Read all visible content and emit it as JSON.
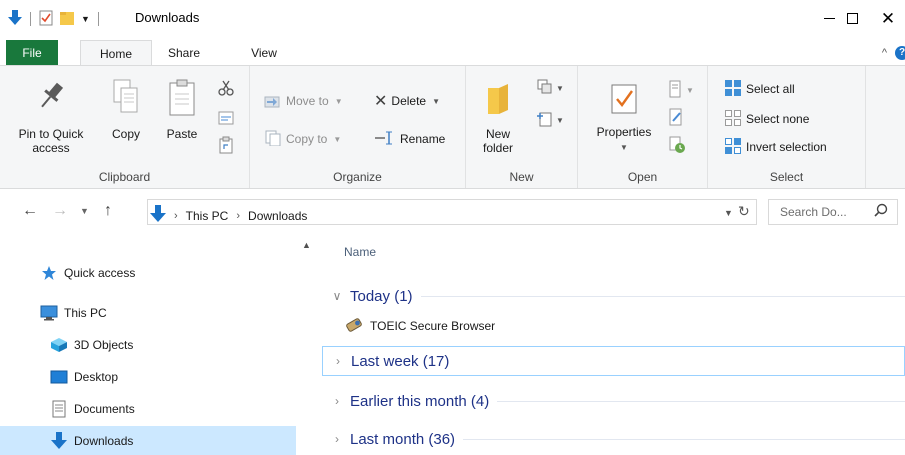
{
  "window": {
    "title": "Downloads",
    "qat": {
      "customize_glyph": "▼"
    },
    "controls": {
      "close_glyph": "✕"
    }
  },
  "tabs": {
    "file": "File",
    "home": "Home",
    "share": "Share",
    "view": "View",
    "collapse_glyph": "^",
    "help_glyph": "?"
  },
  "ribbon": {
    "clipboard": {
      "label": "Clipboard",
      "pin": "Pin to Quick\naccess",
      "copy": "Copy",
      "paste": "Paste"
    },
    "organize": {
      "label": "Organize",
      "move_to": "Move to",
      "copy_to": "Copy to",
      "delete": "Delete",
      "rename": "Rename"
    },
    "new": {
      "label": "New",
      "new_folder": "New\nfolder"
    },
    "open": {
      "label": "Open",
      "properties": "Properties"
    },
    "select": {
      "label": "Select",
      "select_all": "Select all",
      "select_none": "Select none",
      "invert_selection": "Invert selection"
    }
  },
  "address": {
    "crumbs": [
      "This PC",
      "Downloads"
    ],
    "search_placeholder": "Search Do..."
  },
  "nav_pane": {
    "items": [
      {
        "label": "Quick access",
        "icon": "star-icon"
      },
      {
        "label": "This PC",
        "icon": "computer-icon"
      },
      {
        "label": "3D Objects",
        "icon": "cube-icon"
      },
      {
        "label": "Desktop",
        "icon": "desktop-icon"
      },
      {
        "label": "Documents",
        "icon": "documents-icon"
      },
      {
        "label": "Downloads",
        "icon": "download-arrow-icon",
        "selected": true
      }
    ]
  },
  "content": {
    "column_name": "Name",
    "groups": [
      {
        "label": "Today (1)",
        "expanded": true,
        "files": [
          "TOEIC Secure Browser"
        ]
      },
      {
        "label": "Last week (17)",
        "expanded": false,
        "focused": true
      },
      {
        "label": "Earlier this month (4)",
        "expanded": false
      },
      {
        "label": "Last month (36)",
        "expanded": false
      }
    ]
  },
  "colors": {
    "file_tab": "#19783c",
    "accent_blue": "#1a73c8",
    "group_header": "#1e3287",
    "selection": "#cce8ff",
    "ribbon_bg": "#f5f6f7"
  }
}
